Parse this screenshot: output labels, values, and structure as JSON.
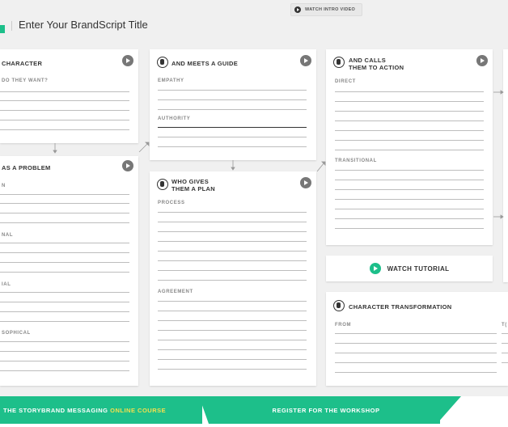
{
  "header": {
    "intro_video_label": "WATCH INTRO VIDEO",
    "title": "Enter Your BrandScript Title"
  },
  "cards": {
    "character": {
      "title": "CHARACTER",
      "sections": [
        "DO THEY WANT?"
      ]
    },
    "problem": {
      "title": "AS A PROBLEM",
      "sections": [
        "N",
        "NAL",
        "IAL",
        "SOPHICAL"
      ]
    },
    "guide": {
      "title": "AND MEETS A GUIDE",
      "sections": [
        "EMPATHY",
        "AUTHORITY"
      ]
    },
    "plan": {
      "title_line1": "WHO GIVES",
      "title_line2": "THEM A PLAN",
      "sections": [
        "PROCESS",
        "AGREEMENT"
      ]
    },
    "action": {
      "title_line1": "AND CALLS",
      "title_line2": "THEM TO ACTION",
      "sections": [
        "DIRECT",
        "TRANSITIONAL"
      ]
    },
    "transformation": {
      "title": "CHARACTER TRANSFORMATION",
      "from_label": "FROM",
      "to_label": "T("
    }
  },
  "tutorial": {
    "label": "WATCH TUTORIAL"
  },
  "footer": {
    "course_prefix": "THE",
    "course_main": "STORYBRAND MESSAGING",
    "course_suffix": "ONLINE COURSE",
    "workshop": "REGISTER FOR THE WORKSHOP"
  },
  "colors": {
    "accent": "#1dbf8a",
    "highlight": "#f4e04d",
    "background": "#f0f0f0"
  }
}
